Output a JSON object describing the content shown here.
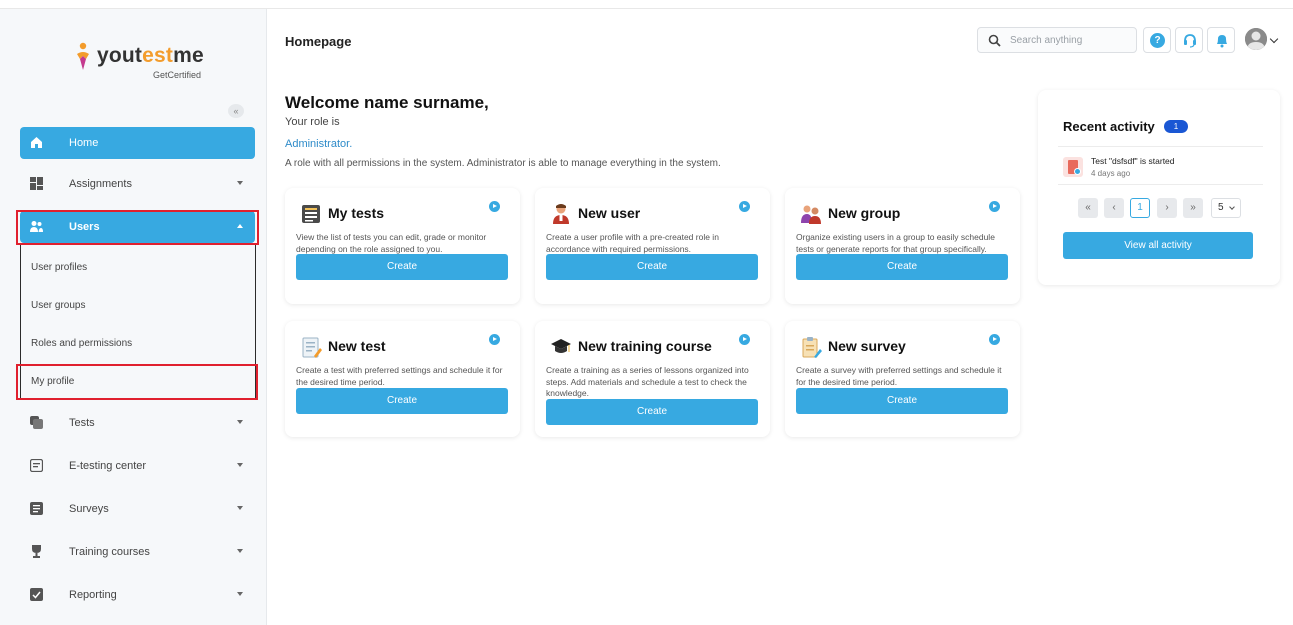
{
  "app": {
    "logo_brand_left": "yout",
    "logo_brand_accent": "est",
    "logo_brand_right": "me",
    "logo_sub": "GetCertified",
    "page_title": "Homepage"
  },
  "header": {
    "search_placeholder": "Search anything",
    "help_icon": "question-icon",
    "support_icon": "headset-icon",
    "notification_icon": "bell-icon"
  },
  "sidebar": {
    "collapse_label": "«",
    "items": [
      {
        "label": "Home",
        "icon": "home-icon"
      },
      {
        "label": "Assignments",
        "icon": "assignments-icon"
      },
      {
        "label": "Users",
        "icon": "users-icon"
      },
      {
        "label": "Tests",
        "icon": "tests-icon"
      },
      {
        "label": "E-testing center",
        "icon": "etesting-icon"
      },
      {
        "label": "Surveys",
        "icon": "surveys-icon"
      },
      {
        "label": "Training courses",
        "icon": "trophy-icon"
      },
      {
        "label": "Reporting",
        "icon": "reporting-icon"
      }
    ],
    "users_submenu": [
      "User profiles",
      "User groups",
      "Roles and permissions",
      "My profile"
    ]
  },
  "welcome": {
    "title": "Welcome name surname,",
    "role_label": "Your role is",
    "role_name": "Administrator.",
    "role_desc": "A role with all permissions in the system. Administrator is able to manage everything in the system."
  },
  "cards": [
    {
      "title": "My tests",
      "desc": "View the list of tests you can edit, grade or monitor depending on the role assigned to you.",
      "button": "Create"
    },
    {
      "title": "New user",
      "desc": "Create a user profile with a pre-created role in accordance with required permissions.",
      "button": "Create"
    },
    {
      "title": "New group",
      "desc": "Organize existing users in a group to easily schedule tests or generate reports for that group specifically.",
      "button": "Create"
    },
    {
      "title": "New test",
      "desc": "Create a test with preferred settings and schedule it for the desired time period.",
      "button": "Create"
    },
    {
      "title": "New training course",
      "desc": "Create a training as a series of lessons organized into steps. Add materials and schedule a test to check the knowledge.",
      "button": "Create"
    },
    {
      "title": "New survey",
      "desc": "Create a survey with preferred settings and schedule it for the desired time period.",
      "button": "Create"
    }
  ],
  "recent_activity": {
    "title": "Recent activity",
    "badge": "1",
    "items": [
      {
        "text": "Test \"dsfsdf\" is started",
        "time": "4 days ago"
      }
    ],
    "pagination": {
      "first": "«",
      "prev": "‹",
      "current": "1",
      "next": "›",
      "last": "»",
      "page_size": "5"
    },
    "view_all": "View all activity"
  },
  "colors": {
    "accent": "#37a9e1",
    "highlight": "#e0202e",
    "badge": "#1a57d4",
    "logo_orange": "#f39c2c"
  }
}
